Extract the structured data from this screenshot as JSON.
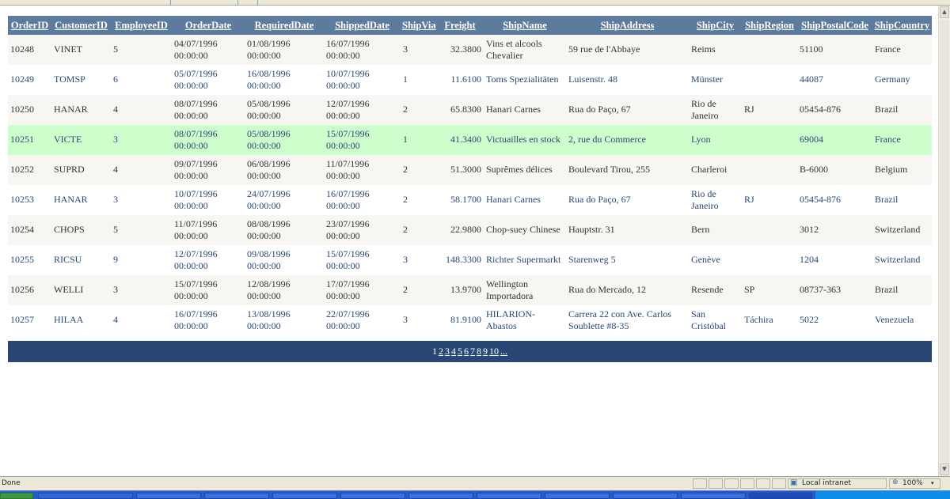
{
  "grid": {
    "columns": [
      "OrderID",
      "CustomerID",
      "EmployeeID",
      "OrderDate",
      "RequiredDate",
      "ShippedDate",
      "ShipVia",
      "Freight",
      "ShipName",
      "ShipAddress",
      "ShipCity",
      "ShipRegion",
      "ShipPostalCode",
      "ShipCountry"
    ],
    "rows": [
      [
        "10248",
        "VINET",
        "5",
        "04/07/1996 00:00:00",
        "01/08/1996 00:00:00",
        "16/07/1996 00:00:00",
        "3",
        "32.3800",
        "Vins et alcools Chevalier",
        "59 rue de l'Abbaye",
        "Reims",
        "",
        "51100",
        "France"
      ],
      [
        "10249",
        "TOMSP",
        "6",
        "05/07/1996 00:00:00",
        "16/08/1996 00:00:00",
        "10/07/1996 00:00:00",
        "1",
        "11.6100",
        "Toms Spezialitäten",
        "Luisenstr. 48",
        "Münster",
        "",
        "44087",
        "Germany"
      ],
      [
        "10250",
        "HANAR",
        "4",
        "08/07/1996 00:00:00",
        "05/08/1996 00:00:00",
        "12/07/1996 00:00:00",
        "2",
        "65.8300",
        "Hanari Carnes",
        "Rua do Paço, 67",
        "Rio de Janeiro",
        "RJ",
        "05454-876",
        "Brazil"
      ],
      [
        "10251",
        "VICTE",
        "3",
        "08/07/1996 00:00:00",
        "05/08/1996 00:00:00",
        "15/07/1996 00:00:00",
        "1",
        "41.3400",
        "Victuailles en stock",
        "2, rue du Commerce",
        "Lyon",
        "",
        "69004",
        "France"
      ],
      [
        "10252",
        "SUPRD",
        "4",
        "09/07/1996 00:00:00",
        "06/08/1996 00:00:00",
        "11/07/1996 00:00:00",
        "2",
        "51.3000",
        "Suprêmes délices",
        "Boulevard Tirou, 255",
        "Charleroi",
        "",
        "B-6000",
        "Belgium"
      ],
      [
        "10253",
        "HANAR",
        "3",
        "10/07/1996 00:00:00",
        "24/07/1996 00:00:00",
        "16/07/1996 00:00:00",
        "2",
        "58.1700",
        "Hanari Carnes",
        "Rua do Paço, 67",
        "Rio de Janeiro",
        "RJ",
        "05454-876",
        "Brazil"
      ],
      [
        "10254",
        "CHOPS",
        "5",
        "11/07/1996 00:00:00",
        "08/08/1996 00:00:00",
        "23/07/1996 00:00:00",
        "2",
        "22.9800",
        "Chop-suey Chinese",
        "Hauptstr. 31",
        "Bern",
        "",
        "3012",
        "Switzerland"
      ],
      [
        "10255",
        "RICSU",
        "9",
        "12/07/1996 00:00:00",
        "09/08/1996 00:00:00",
        "15/07/1996 00:00:00",
        "3",
        "148.3300",
        "Richter Supermarkt",
        "Starenweg 5",
        "Genève",
        "",
        "1204",
        "Switzerland"
      ],
      [
        "10256",
        "WELLI",
        "3",
        "15/07/1996 00:00:00",
        "12/08/1996 00:00:00",
        "17/07/1996 00:00:00",
        "2",
        "13.9700",
        "Wellington Importadora",
        "Rua do Mercado, 12",
        "Resende",
        "SP",
        "08737-363",
        "Brazil"
      ],
      [
        "10257",
        "HILAA",
        "4",
        "16/07/1996 00:00:00",
        "13/08/1996 00:00:00",
        "22/07/1996 00:00:00",
        "3",
        "81.9100",
        "HILARION-Abastos",
        "Carrera 22 con Ave. Carlos Soublette #8-35",
        "San Cristóbal",
        "Táchira",
        "5022",
        "Venezuela"
      ]
    ],
    "selected_row": 3
  },
  "pager": {
    "pages": [
      "1",
      "2",
      "3",
      "4",
      "5",
      "6",
      "7",
      "8",
      "9",
      "10",
      "..."
    ],
    "current": "1"
  },
  "status": {
    "text": "Done",
    "zone": "Local intranet",
    "zoom": "100%"
  },
  "colors": {
    "header_bg": "#5d7b9d",
    "pager_bg": "#284775",
    "selected_bg": "#ccffcc",
    "alt_row_bg": "#f7f6f3"
  }
}
